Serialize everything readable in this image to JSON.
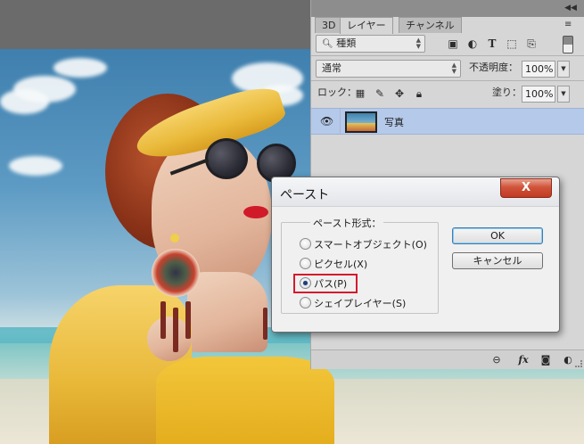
{
  "layers_panel": {
    "tabs": [
      "3D",
      "レイヤー",
      "チャンネル"
    ],
    "active_tab": "レイヤー",
    "filter": {
      "value": "種類",
      "icons": [
        "image-filter-icon",
        "adjustment-filter-icon",
        "type-filter-icon",
        "shape-filter-icon",
        "smart-object-filter-icon",
        "filter-toggle-icon"
      ]
    },
    "blend_mode": "通常",
    "opacity_label": "不透明度：",
    "opacity_value": "100%",
    "lock_label": "ロック：",
    "lock_icons": [
      "lock-transparent-icon",
      "lock-image-icon",
      "lock-position-icon",
      "lock-all-icon"
    ],
    "fill_label": "塗り：",
    "fill_value": "100%",
    "layers": [
      {
        "name": "写真",
        "visible": true,
        "selected": true
      }
    ],
    "bottom_icons": [
      "link-icon",
      "fx-icon",
      "mask-icon",
      "adjustment-icon"
    ],
    "bottom_fx_label": "fx"
  },
  "paste_dialog": {
    "title": "ペースト",
    "close_label": "X",
    "group_label": "ペースト形式：",
    "options": [
      {
        "label": "スマートオブジェクト(O)",
        "checked": false
      },
      {
        "label": "ピクセル(X)",
        "checked": false
      },
      {
        "label": "パス(P)",
        "checked": true
      },
      {
        "label": "シェイプレイヤー(S)",
        "checked": false
      }
    ],
    "ok_label": "OK",
    "cancel_label": "キャンセル",
    "highlight_color": "#d51a2b"
  },
  "colors": {
    "selected_layer": "#b5c9ea",
    "panel_bg": "#d6d6d6",
    "close_button": "#c13a22"
  }
}
